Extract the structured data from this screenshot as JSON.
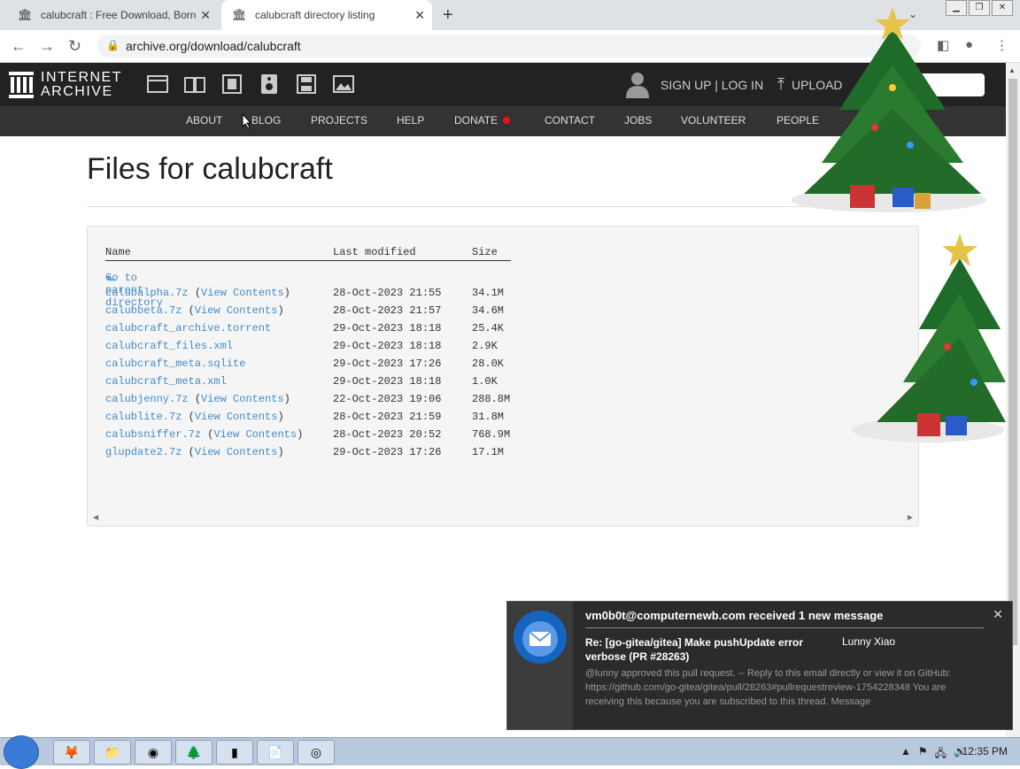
{
  "browser": {
    "tabs": [
      {
        "title": "calubcraft : Free Download, Borro",
        "active": false
      },
      {
        "title": "calubcraft directory listing",
        "active": true
      }
    ],
    "url": "archive.org/download/calubcraft"
  },
  "ia": {
    "logo_line1": "INTERNET",
    "logo_line2": "ARCHIVE",
    "signup": "SIGN UP | LOG IN",
    "upload": "UPLOAD",
    "nav": [
      "ABOUT",
      "BLOG",
      "PROJECTS",
      "HELP",
      "DONATE",
      "CONTACT",
      "JOBS",
      "VOLUNTEER",
      "PEOPLE"
    ]
  },
  "page": {
    "title": "Files for calubcraft",
    "columns": [
      "Name",
      "Last modified",
      "Size"
    ],
    "parent_link": "Go to parent directory",
    "view_contents": "View Contents",
    "files": [
      {
        "name": "calubalpha.7z",
        "view": true,
        "modified": "28-Oct-2023 21:55",
        "size": "34.1M"
      },
      {
        "name": "calubbeta.7z",
        "view": true,
        "modified": "28-Oct-2023 21:57",
        "size": "34.6M"
      },
      {
        "name": "calubcraft_archive.torrent",
        "view": false,
        "modified": "29-Oct-2023 18:18",
        "size": "25.4K"
      },
      {
        "name": "calubcraft_files.xml",
        "view": false,
        "modified": "29-Oct-2023 18:18",
        "size": "2.9K"
      },
      {
        "name": "calubcraft_meta.sqlite",
        "view": false,
        "modified": "29-Oct-2023 17:26",
        "size": "28.0K"
      },
      {
        "name": "calubcraft_meta.xml",
        "view": false,
        "modified": "29-Oct-2023 18:18",
        "size": "1.0K"
      },
      {
        "name": "calubjenny.7z",
        "view": true,
        "modified": "22-Oct-2023 19:06",
        "size": "288.8M"
      },
      {
        "name": "calublite.7z",
        "view": true,
        "modified": "28-Oct-2023 21:59",
        "size": "31.8M"
      },
      {
        "name": "calubsniffer.7z",
        "view": true,
        "modified": "28-Oct-2023 20:52",
        "size": "768.9M"
      },
      {
        "name": "glupdate2.7z",
        "view": true,
        "modified": "29-Oct-2023 17:26",
        "size": "17.1M"
      }
    ]
  },
  "notification": {
    "from": "vm0b0t@computernewb.com received 1 new message",
    "subject": "Re: [go-gitea/gitea] Make pushUpdate error verbose (PR #28263)",
    "sender": "Lunny Xiao",
    "body": "@lunny approved this pull request. -- Reply to this email directly or view it on GitHub: https://github.com/go-gitea/gitea/pull/28263#pullrequestreview-1754228348 You are receiving this because you are subscribed to this thread. Message"
  },
  "taskbar": {
    "clock": "12:35 PM"
  }
}
